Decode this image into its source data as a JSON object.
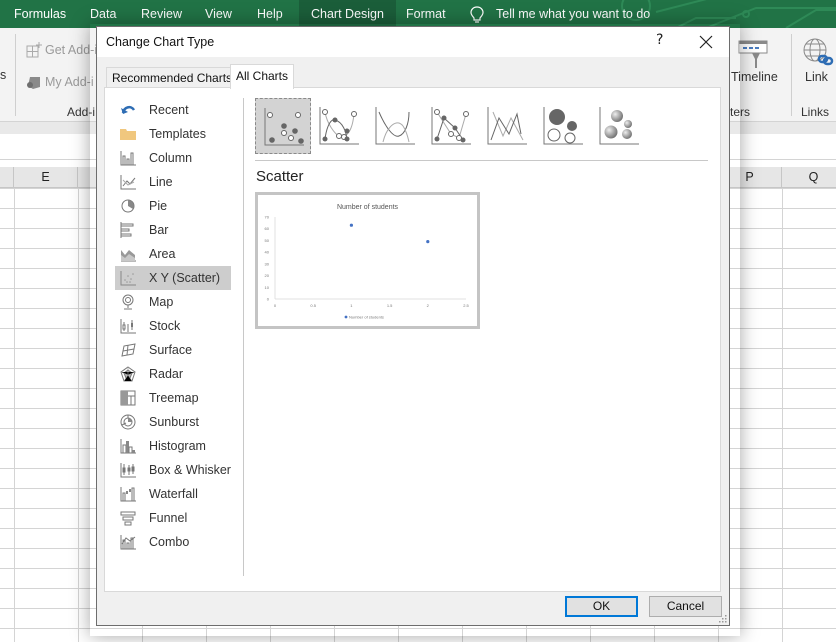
{
  "ribbon": {
    "tabs": [
      "Formulas",
      "Data",
      "Review",
      "View",
      "Help",
      "Chart Design",
      "Format"
    ],
    "active_context_tab": "Chart Design",
    "tell_me": "Tell me what you want to do",
    "left_partial_label": "s",
    "get_addins": "Get Add-i",
    "my_addins": "My Add-i",
    "addins_group": "Add-i",
    "timeline": "Timeline",
    "filters_group": "ters",
    "link": "Link",
    "links_group": "Links",
    "colors": {
      "ribbon_green": "#217346",
      "context_tab": "#1b5e3a"
    }
  },
  "sheet": {
    "columns_left": [
      "E"
    ],
    "columns_right": [
      "P",
      "Q"
    ]
  },
  "dialog": {
    "title": "Change Chart Type",
    "help": "?",
    "tabs": [
      {
        "label": "Recommended Charts",
        "active": false
      },
      {
        "label": "All Charts",
        "active": true
      }
    ],
    "categories": [
      {
        "label": "Recent",
        "icon": "recent-icon"
      },
      {
        "label": "Templates",
        "icon": "templates-folder-icon"
      },
      {
        "label": "Column",
        "icon": "column-chart-icon"
      },
      {
        "label": "Line",
        "icon": "line-chart-icon"
      },
      {
        "label": "Pie",
        "icon": "pie-chart-icon"
      },
      {
        "label": "Bar",
        "icon": "bar-chart-icon"
      },
      {
        "label": "Area",
        "icon": "area-chart-icon"
      },
      {
        "label": "X Y (Scatter)",
        "icon": "scatter-chart-icon",
        "selected": true
      },
      {
        "label": "Map",
        "icon": "map-chart-icon"
      },
      {
        "label": "Stock",
        "icon": "stock-chart-icon"
      },
      {
        "label": "Surface",
        "icon": "surface-chart-icon"
      },
      {
        "label": "Radar",
        "icon": "radar-chart-icon"
      },
      {
        "label": "Treemap",
        "icon": "treemap-chart-icon"
      },
      {
        "label": "Sunburst",
        "icon": "sunburst-chart-icon"
      },
      {
        "label": "Histogram",
        "icon": "histogram-chart-icon"
      },
      {
        "label": "Box & Whisker",
        "icon": "box-whisker-chart-icon"
      },
      {
        "label": "Waterfall",
        "icon": "waterfall-chart-icon"
      },
      {
        "label": "Funnel",
        "icon": "funnel-chart-icon"
      },
      {
        "label": "Combo",
        "icon": "combo-chart-icon"
      }
    ],
    "subtypes": [
      {
        "name": "scatter",
        "icon": "scatter-markers-icon",
        "selected": true
      },
      {
        "name": "scatter-smooth-lines-markers",
        "icon": "scatter-smooth-lines-markers-icon"
      },
      {
        "name": "scatter-smooth-lines",
        "icon": "scatter-smooth-lines-icon"
      },
      {
        "name": "scatter-straight-lines-markers",
        "icon": "scatter-straight-lines-markers-icon"
      },
      {
        "name": "scatter-straight-lines",
        "icon": "scatter-straight-lines-icon"
      },
      {
        "name": "bubble",
        "icon": "bubble-icon"
      },
      {
        "name": "3d-bubble",
        "icon": "3d-bubble-icon"
      }
    ],
    "selected_subtype_name": "Scatter",
    "ok": "OK",
    "cancel": "Cancel",
    "accent": "#0078d7"
  },
  "chart_data": {
    "type": "scatter",
    "title": "Number of students",
    "xlabel": "",
    "ylabel": "",
    "x_ticks": [
      "0",
      "0.5",
      "1",
      "1.5",
      "2",
      "2.5"
    ],
    "y_ticks": [
      "0",
      "10",
      "20",
      "30",
      "40",
      "50",
      "60",
      "70"
    ],
    "xlim": [
      0,
      2.5
    ],
    "ylim": [
      0,
      70
    ],
    "series": [
      {
        "name": "Number of students",
        "color": "#4472c4",
        "points": [
          [
            1,
            63
          ],
          [
            2,
            49
          ]
        ]
      }
    ],
    "legend": "bottom",
    "grid": false
  }
}
